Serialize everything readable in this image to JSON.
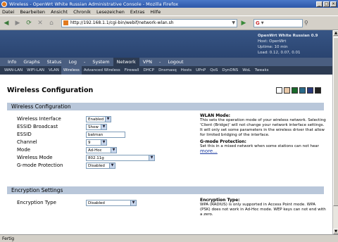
{
  "window": {
    "title": "Wireless - OpenWrt White Russian Administrative Console - Mozilla Firefox"
  },
  "menu": [
    "Datei",
    "Bearbeiten",
    "Ansicht",
    "Chronik",
    "Lesezeichen",
    "Extras",
    "Hilfe"
  ],
  "address": {
    "url": "http://192.168.1.1/cgi-bin/webif/network-wlan.sh"
  },
  "router": {
    "host_lines": [
      "OpenWrt White Russian 0.9",
      "Host: OpenWrt",
      "Uptime: 10 min",
      "Load: 0.12, 0.07, 0.01"
    ]
  },
  "main_tabs": [
    "Info",
    "Graphs",
    "Status",
    "Log",
    "-",
    "System",
    "Network",
    "VPN",
    "-",
    "Logout"
  ],
  "sub_tabs": [
    "WAN-LAN",
    "WIFI-LAN",
    "VLAN",
    "Wireless",
    "Advanced Wireless",
    "Firewall",
    "DHCP",
    "Dnsmasq",
    "Hosts",
    "UPnP",
    "QoS",
    "DynDNS",
    "WoL",
    "Tweaks"
  ],
  "page": {
    "title": "Wireless Configuration"
  },
  "swatches": [
    "#ffffff",
    "#e8c8a8",
    "#1a6a2a",
    "#2a6a8a",
    "#2a3a7a",
    "#222222"
  ],
  "wireless_section": {
    "heading": "Wireless Configuration",
    "fields": [
      {
        "label": "Wireless Interface",
        "value": "Enabled"
      },
      {
        "label": "ESSID Broadcast",
        "value": "Show"
      },
      {
        "label": "ESSID",
        "value": "batman"
      },
      {
        "label": "Channel",
        "value": "9"
      },
      {
        "label": "Mode",
        "value": "Ad-Hoc"
      },
      {
        "label": "Wireless Mode",
        "value": "802.11g"
      },
      {
        "label": "G-mode Protection",
        "value": "Disabled"
      }
    ],
    "help_wlan_title": "WLAN Mode:",
    "help_wlan_text": "This sets the operation mode of your wireless network. Selecting 'Client (Bridge)' will not change your network interface settings. It will only set some parameters in the wireless driver that allow for limited bridging of the interface.",
    "help_gmode_title": "G-mode Protection:",
    "help_gmode_text": "Set this in a mixed network when some stations can not hear",
    "more_link": "more..."
  },
  "encryption_section": {
    "heading": "Encryption Settings",
    "field_label": "Encryption Type",
    "field_value": "Disabled",
    "help_title": "Encryption Type:",
    "help_text": "WPA (RADIUS) is only supported in Access Point mode. WPA (PSK) does not work in Ad-Hoc mode. WEP keys can not end with a zero."
  },
  "status": {
    "text": "Fertig"
  }
}
